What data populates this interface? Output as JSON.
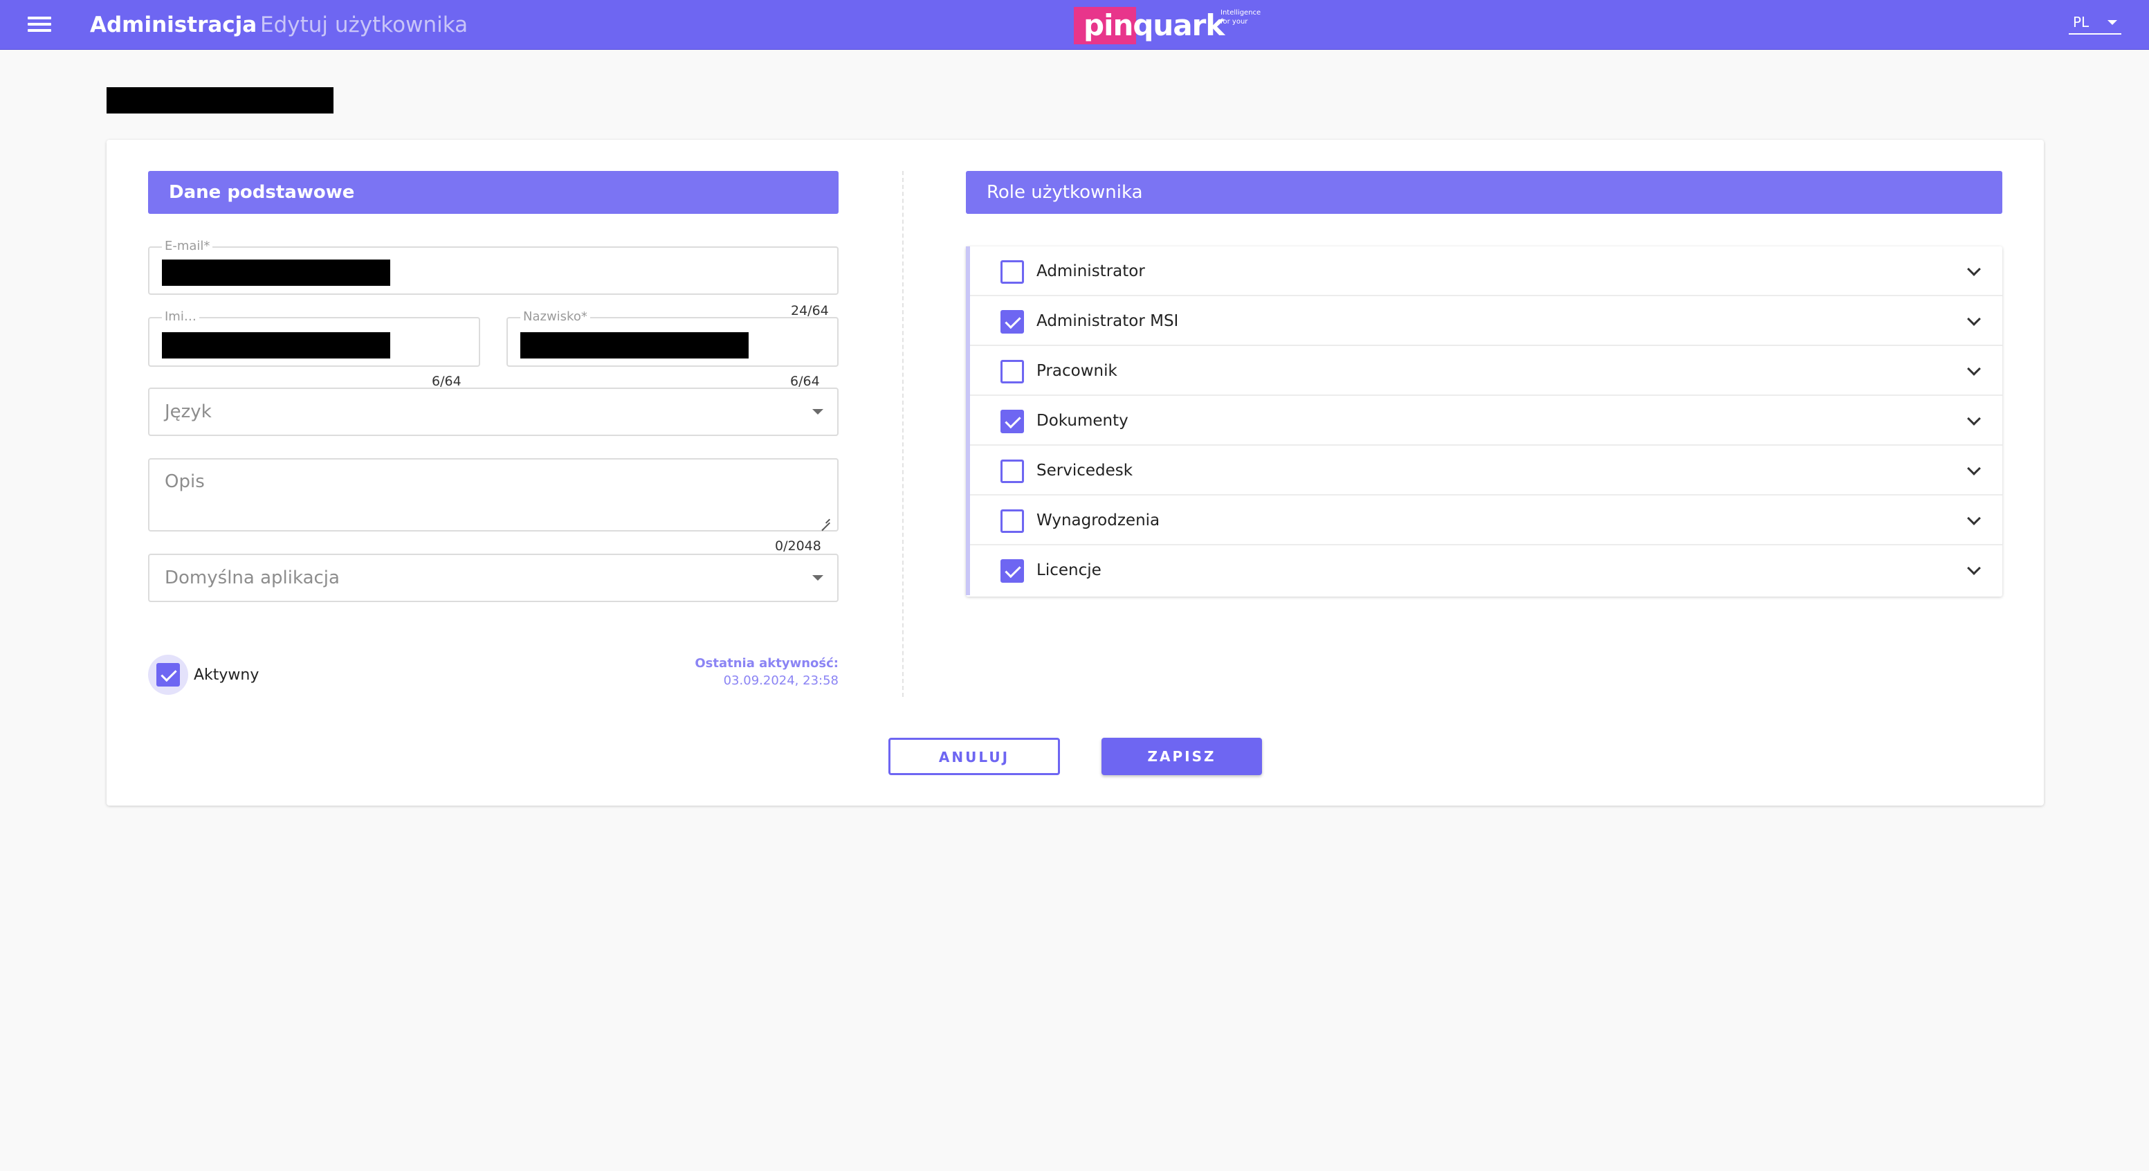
{
  "header": {
    "app_title": "Administracja",
    "page_subtitle": "Edytuj użytkownika",
    "logo_text": "pinquark",
    "logo_tagline": "Intelligence for your",
    "language": "PL",
    "colors": {
      "primary": "#6e66f2",
      "logo_accent": "#e8358b"
    }
  },
  "basic": {
    "title": "Dane podstawowe",
    "email": {
      "label": "E-mail*",
      "counter": "24/64"
    },
    "first_name": {
      "label": "Imi…",
      "counter": "6/64"
    },
    "last_name": {
      "label": "Nazwisko*",
      "counter": "6/64"
    },
    "language": {
      "placeholder": "Język"
    },
    "description": {
      "placeholder": "Opis",
      "counter": "0/2048"
    },
    "default_app": {
      "placeholder": "Domyślna aplikacja"
    },
    "active": {
      "label": "Aktywny",
      "checked": true
    },
    "last_activity": {
      "label": "Ostatnia aktywność:",
      "value": "03.09.2024, 23:58"
    }
  },
  "roles": {
    "title": "Role użytkownika",
    "items": [
      {
        "label": "Administrator",
        "checked": false
      },
      {
        "label": "Administrator MSI",
        "checked": true
      },
      {
        "label": "Pracownik",
        "checked": false
      },
      {
        "label": "Dokumenty",
        "checked": true
      },
      {
        "label": "Servicedesk",
        "checked": false
      },
      {
        "label": "Wynagrodzenia",
        "checked": false
      },
      {
        "label": "Licencje",
        "checked": true
      }
    ]
  },
  "actions": {
    "cancel": "ANULUJ",
    "save": "ZAPISZ"
  }
}
